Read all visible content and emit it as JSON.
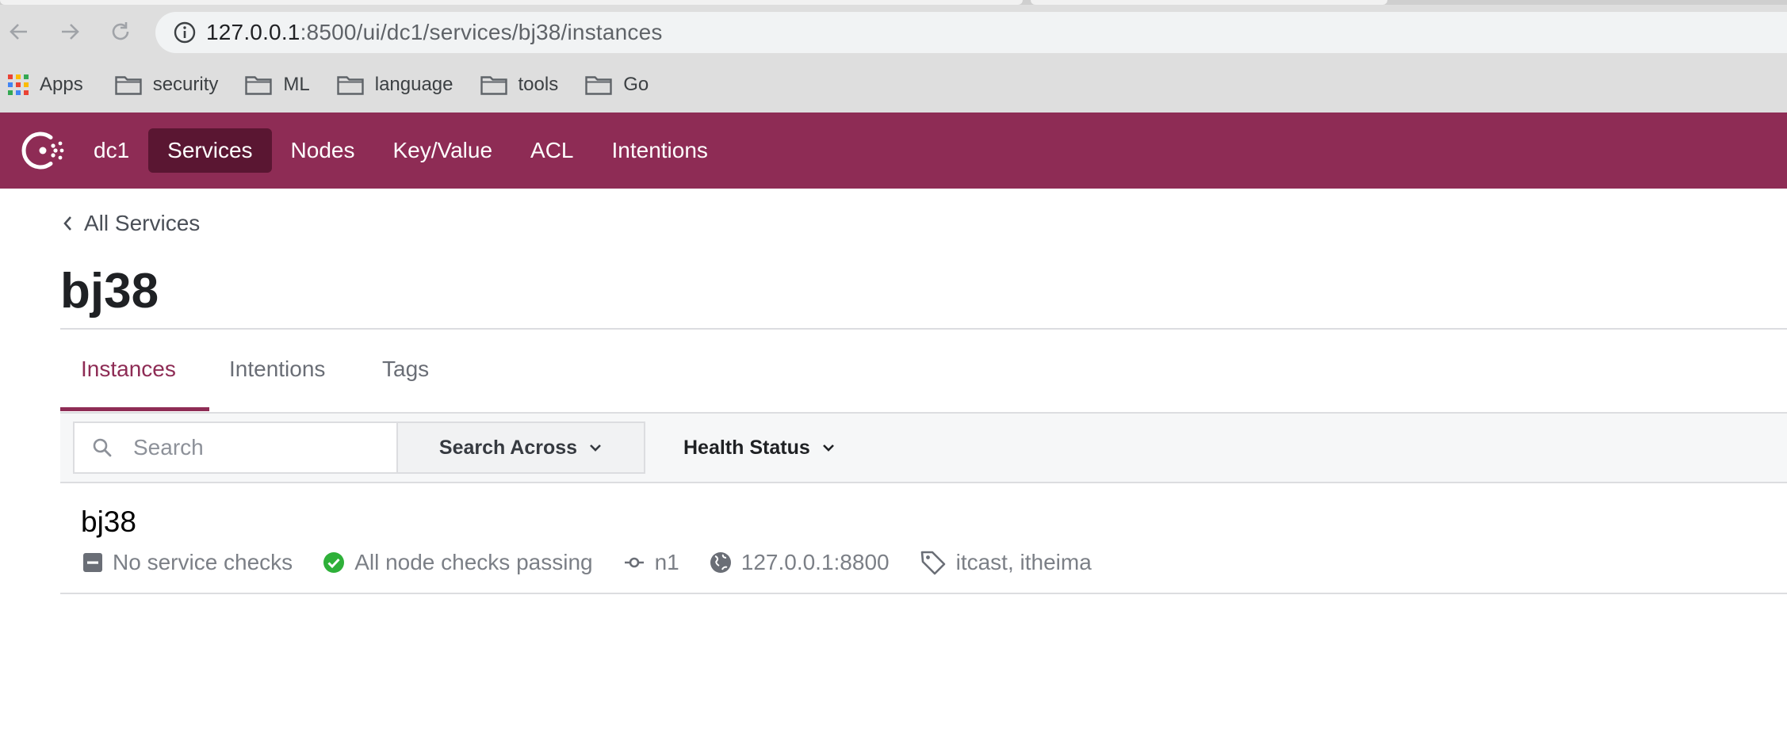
{
  "browser": {
    "url_host": "127.0.0.1",
    "url_path": ":8500/ui/dc1/services/bj38/instances",
    "bookmarks": [
      {
        "label": "Apps",
        "icon": "apps-grid-icon"
      },
      {
        "label": "security",
        "icon": "folder-icon"
      },
      {
        "label": "ML",
        "icon": "folder-icon"
      },
      {
        "label": "language",
        "icon": "folder-icon"
      },
      {
        "label": "tools",
        "icon": "folder-icon"
      },
      {
        "label": "Go",
        "icon": "folder-icon"
      }
    ]
  },
  "header": {
    "brand_color": "#8e2c55",
    "datacenter": "dc1",
    "nav": [
      {
        "label": "Services",
        "active": true
      },
      {
        "label": "Nodes"
      },
      {
        "label": "Key/Value"
      },
      {
        "label": "ACL"
      },
      {
        "label": "Intentions"
      }
    ]
  },
  "breadcrumb": {
    "label": "All Services"
  },
  "page": {
    "title": "bj38"
  },
  "tabs": [
    {
      "label": "Instances",
      "active": true
    },
    {
      "label": "Intentions"
    },
    {
      "label": "Tags"
    }
  ],
  "filters": {
    "search_placeholder": "Search",
    "search_across_label": "Search Across",
    "health_status_label": "Health Status"
  },
  "instances": [
    {
      "name": "bj38",
      "service_checks": "No service checks",
      "node_checks": "All node checks passing",
      "node": "n1",
      "address": "127.0.0.1:8800",
      "tags": "itcast, itheima",
      "passing_color": "#2eb039"
    }
  ]
}
